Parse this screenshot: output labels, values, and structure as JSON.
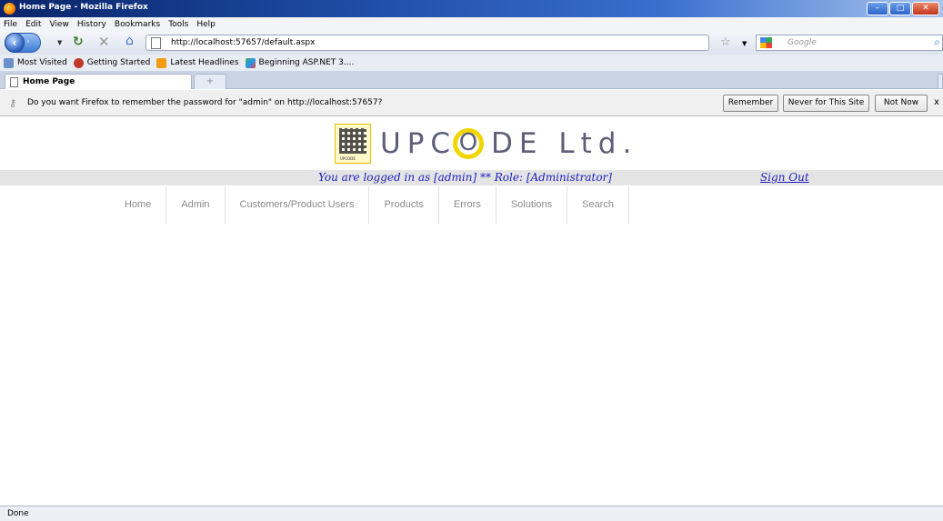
{
  "window": {
    "title": "Home Page - Mozilla Firefox"
  },
  "menu": [
    "File",
    "Edit",
    "View",
    "History",
    "Bookmarks",
    "Tools",
    "Help"
  ],
  "toolbar": {
    "url": "http://localhost:57657/default.aspx",
    "search_placeholder": "Google"
  },
  "bookmarks": [
    {
      "label": "Most Visited",
      "color": "#6b8fc8"
    },
    {
      "label": "Getting Started",
      "color": "#c0392b"
    },
    {
      "label": "Latest Headlines",
      "color": "#f39c12"
    },
    {
      "label": "Beginning ASP.NET 3....",
      "color": "#4caf50"
    }
  ],
  "tabs": {
    "active_label": "Home Page",
    "new_tab_symbol": "+"
  },
  "notification": {
    "message": "Do you want Firefox to remember the password for \"admin\" on http://localhost:57657?",
    "remember": "Remember",
    "never": "Never for This Site",
    "not_now": "Not Now",
    "close": "x"
  },
  "page": {
    "logo_text_pre": "UPC",
    "logo_text_o": "O",
    "logo_text_post": "DE Ltd.",
    "logo_small": "UPCODE",
    "login_text": "You are logged in as [admin] ** Role: [Administrator]",
    "sign_out": "Sign Out",
    "nav": [
      "Home",
      "Admin",
      "Customers/Product Users",
      "Products",
      "Errors",
      "Solutions",
      "Search"
    ]
  },
  "status": {
    "text": "Done"
  }
}
